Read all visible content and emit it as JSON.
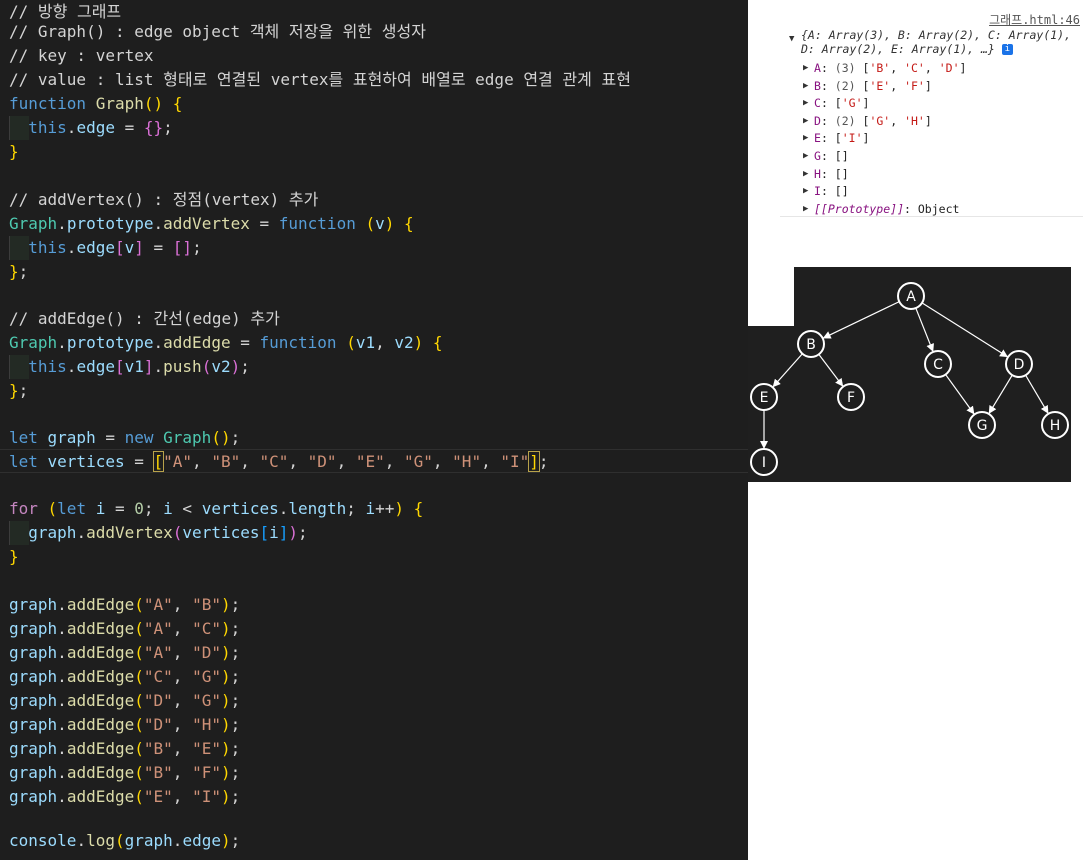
{
  "editor": {
    "lines": [
      {
        "t": 0,
        "parts": [
          {
            "c": "c-comment",
            "s": "// 방향 그래프"
          }
        ]
      },
      {
        "t": 20,
        "parts": [
          {
            "c": "c-comment",
            "s": "// Graph() : edge object 객체 저장을 위한 생성자"
          }
        ]
      },
      {
        "t": 44,
        "parts": [
          {
            "c": "c-comment",
            "s": "// key : vertex"
          }
        ]
      },
      {
        "t": 68,
        "parts": [
          {
            "c": "c-comment",
            "s": "// value : list 형태로 연결된 vertex를 표현하여 배열로 edge 연결 관계 표현"
          }
        ]
      },
      {
        "t": 92,
        "parts": [
          {
            "c": "c-kw",
            "s": "function "
          },
          {
            "c": "c-fn",
            "s": "Graph"
          },
          {
            "c": "c-b1",
            "s": "() {"
          }
        ]
      },
      {
        "t": 116,
        "guide": true,
        "parts": [
          {
            "c": "",
            "s": "  "
          },
          {
            "c": "c-kw",
            "s": "this"
          },
          {
            "c": "",
            "s": "."
          },
          {
            "c": "c-var",
            "s": "edge"
          },
          {
            "c": "",
            "s": " = "
          },
          {
            "c": "c-b2",
            "s": "{}"
          },
          {
            "c": "",
            "s": ";"
          }
        ]
      },
      {
        "t": 140,
        "parts": [
          {
            "c": "c-b1",
            "s": "}"
          }
        ]
      },
      {
        "t": 188,
        "parts": [
          {
            "c": "c-comment",
            "s": "// addVertex() : 정점(vertex) 추가"
          }
        ]
      },
      {
        "t": 212,
        "parts": [
          {
            "c": "c-cls",
            "s": "Graph"
          },
          {
            "c": "",
            "s": "."
          },
          {
            "c": "c-var",
            "s": "prototype"
          },
          {
            "c": "",
            "s": "."
          },
          {
            "c": "c-fn",
            "s": "addVertex"
          },
          {
            "c": "",
            "s": " = "
          },
          {
            "c": "c-kw",
            "s": "function "
          },
          {
            "c": "c-b1",
            "s": "("
          },
          {
            "c": "c-var",
            "s": "v"
          },
          {
            "c": "c-b1",
            "s": ")"
          },
          {
            "c": "",
            "s": " "
          },
          {
            "c": "c-b1",
            "s": "{"
          }
        ]
      },
      {
        "t": 236,
        "guide": true,
        "parts": [
          {
            "c": "",
            "s": "  "
          },
          {
            "c": "c-kw",
            "s": "this"
          },
          {
            "c": "",
            "s": "."
          },
          {
            "c": "c-var",
            "s": "edge"
          },
          {
            "c": "c-b2",
            "s": "["
          },
          {
            "c": "c-var",
            "s": "v"
          },
          {
            "c": "c-b2",
            "s": "]"
          },
          {
            "c": "",
            "s": " = "
          },
          {
            "c": "c-b2",
            "s": "[]"
          },
          {
            "c": "",
            "s": ";"
          }
        ]
      },
      {
        "t": 260,
        "parts": [
          {
            "c": "c-b1",
            "s": "}"
          },
          {
            "c": "",
            "s": ";"
          }
        ]
      },
      {
        "t": 307,
        "parts": [
          {
            "c": "c-comment",
            "s": "// addEdge() : 간선(edge) 추가"
          }
        ]
      },
      {
        "t": 331,
        "parts": [
          {
            "c": "c-cls",
            "s": "Graph"
          },
          {
            "c": "",
            "s": "."
          },
          {
            "c": "c-var",
            "s": "prototype"
          },
          {
            "c": "",
            "s": "."
          },
          {
            "c": "c-fn",
            "s": "addEdge"
          },
          {
            "c": "",
            "s": " = "
          },
          {
            "c": "c-kw",
            "s": "function "
          },
          {
            "c": "c-b1",
            "s": "("
          },
          {
            "c": "c-var",
            "s": "v1"
          },
          {
            "c": "",
            "s": ", "
          },
          {
            "c": "c-var",
            "s": "v2"
          },
          {
            "c": "c-b1",
            "s": ")"
          },
          {
            "c": "",
            "s": " "
          },
          {
            "c": "c-b1",
            "s": "{"
          }
        ]
      },
      {
        "t": 355,
        "guide": true,
        "parts": [
          {
            "c": "",
            "s": "  "
          },
          {
            "c": "c-kw",
            "s": "this"
          },
          {
            "c": "",
            "s": "."
          },
          {
            "c": "c-var",
            "s": "edge"
          },
          {
            "c": "c-b2",
            "s": "["
          },
          {
            "c": "c-var",
            "s": "v1"
          },
          {
            "c": "c-b2",
            "s": "]"
          },
          {
            "c": "",
            "s": "."
          },
          {
            "c": "c-fn",
            "s": "push"
          },
          {
            "c": "c-b2",
            "s": "("
          },
          {
            "c": "c-var",
            "s": "v2"
          },
          {
            "c": "c-b2",
            "s": ")"
          },
          {
            "c": "",
            "s": ";"
          }
        ]
      },
      {
        "t": 379,
        "parts": [
          {
            "c": "c-b1",
            "s": "}"
          },
          {
            "c": "",
            "s": ";"
          }
        ]
      },
      {
        "t": 426,
        "parts": [
          {
            "c": "c-kw",
            "s": "let "
          },
          {
            "c": "c-var",
            "s": "graph"
          },
          {
            "c": "",
            "s": " = "
          },
          {
            "c": "c-kw",
            "s": "new "
          },
          {
            "c": "c-cls",
            "s": "Graph"
          },
          {
            "c": "c-b1",
            "s": "()"
          },
          {
            "c": "",
            "s": ";"
          }
        ]
      },
      {
        "t": 450,
        "parts": [
          {
            "c": "c-kw",
            "s": "let "
          },
          {
            "c": "c-var",
            "s": "vertices"
          },
          {
            "c": "",
            "s": " = "
          },
          {
            "c": "c-b1 hl-box",
            "s": "["
          },
          {
            "c": "c-str",
            "s": "\"A\""
          },
          {
            "c": "",
            "s": ", "
          },
          {
            "c": "c-str",
            "s": "\"B\""
          },
          {
            "c": "",
            "s": ", "
          },
          {
            "c": "c-str",
            "s": "\"C\""
          },
          {
            "c": "",
            "s": ", "
          },
          {
            "c": "c-str",
            "s": "\"D\""
          },
          {
            "c": "",
            "s": ", "
          },
          {
            "c": "c-str",
            "s": "\"E\""
          },
          {
            "c": "",
            "s": ", "
          },
          {
            "c": "c-str",
            "s": "\"G\""
          },
          {
            "c": "",
            "s": ", "
          },
          {
            "c": "c-str",
            "s": "\"H\""
          },
          {
            "c": "",
            "s": ", "
          },
          {
            "c": "c-str",
            "s": "\"I\""
          },
          {
            "c": "c-b1 hl-box",
            "s": "]"
          },
          {
            "c": "",
            "s": ";"
          }
        ]
      },
      {
        "t": 497,
        "parts": [
          {
            "c": "c-ctl",
            "s": "for "
          },
          {
            "c": "c-b1",
            "s": "("
          },
          {
            "c": "c-kw",
            "s": "let "
          },
          {
            "c": "c-var",
            "s": "i"
          },
          {
            "c": "",
            "s": " = "
          },
          {
            "c": "c-num",
            "s": "0"
          },
          {
            "c": "",
            "s": "; "
          },
          {
            "c": "c-var",
            "s": "i"
          },
          {
            "c": "",
            "s": " < "
          },
          {
            "c": "c-var",
            "s": "vertices"
          },
          {
            "c": "",
            "s": "."
          },
          {
            "c": "c-var",
            "s": "length"
          },
          {
            "c": "",
            "s": "; "
          },
          {
            "c": "c-var",
            "s": "i"
          },
          {
            "c": "",
            "s": "++"
          },
          {
            "c": "c-b1",
            "s": ")"
          },
          {
            "c": "",
            "s": " "
          },
          {
            "c": "c-b1",
            "s": "{"
          }
        ]
      },
      {
        "t": 521,
        "guide": true,
        "parts": [
          {
            "c": "",
            "s": "  "
          },
          {
            "c": "c-var",
            "s": "graph"
          },
          {
            "c": "",
            "s": "."
          },
          {
            "c": "c-fn",
            "s": "addVertex"
          },
          {
            "c": "c-b2",
            "s": "("
          },
          {
            "c": "c-var",
            "s": "vertices"
          },
          {
            "c": "c-b3",
            "s": "["
          },
          {
            "c": "c-var",
            "s": "i"
          },
          {
            "c": "c-b3",
            "s": "]"
          },
          {
            "c": "c-b2",
            "s": ")"
          },
          {
            "c": "",
            "s": ";"
          }
        ]
      },
      {
        "t": 545,
        "parts": [
          {
            "c": "c-b1",
            "s": "}"
          }
        ]
      },
      {
        "t": 593,
        "parts": [
          {
            "c": "c-var",
            "s": "graph"
          },
          {
            "c": "",
            "s": "."
          },
          {
            "c": "c-fn",
            "s": "addEdge"
          },
          {
            "c": "c-b1",
            "s": "("
          },
          {
            "c": "c-str",
            "s": "\"A\""
          },
          {
            "c": "",
            "s": ", "
          },
          {
            "c": "c-str",
            "s": "\"B\""
          },
          {
            "c": "c-b1",
            "s": ")"
          },
          {
            "c": "",
            "s": ";"
          }
        ]
      },
      {
        "t": 617,
        "parts": [
          {
            "c": "c-var",
            "s": "graph"
          },
          {
            "c": "",
            "s": "."
          },
          {
            "c": "c-fn",
            "s": "addEdge"
          },
          {
            "c": "c-b1",
            "s": "("
          },
          {
            "c": "c-str",
            "s": "\"A\""
          },
          {
            "c": "",
            "s": ", "
          },
          {
            "c": "c-str",
            "s": "\"C\""
          },
          {
            "c": "c-b1",
            "s": ")"
          },
          {
            "c": "",
            "s": ";"
          }
        ]
      },
      {
        "t": 641,
        "parts": [
          {
            "c": "c-var",
            "s": "graph"
          },
          {
            "c": "",
            "s": "."
          },
          {
            "c": "c-fn",
            "s": "addEdge"
          },
          {
            "c": "c-b1",
            "s": "("
          },
          {
            "c": "c-str",
            "s": "\"A\""
          },
          {
            "c": "",
            "s": ", "
          },
          {
            "c": "c-str",
            "s": "\"D\""
          },
          {
            "c": "c-b1",
            "s": ")"
          },
          {
            "c": "",
            "s": ";"
          }
        ]
      },
      {
        "t": 665,
        "parts": [
          {
            "c": "c-var",
            "s": "graph"
          },
          {
            "c": "",
            "s": "."
          },
          {
            "c": "c-fn",
            "s": "addEdge"
          },
          {
            "c": "c-b1",
            "s": "("
          },
          {
            "c": "c-str",
            "s": "\"C\""
          },
          {
            "c": "",
            "s": ", "
          },
          {
            "c": "c-str",
            "s": "\"G\""
          },
          {
            "c": "c-b1",
            "s": ")"
          },
          {
            "c": "",
            "s": ";"
          }
        ]
      },
      {
        "t": 689,
        "parts": [
          {
            "c": "c-var",
            "s": "graph"
          },
          {
            "c": "",
            "s": "."
          },
          {
            "c": "c-fn",
            "s": "addEdge"
          },
          {
            "c": "c-b1",
            "s": "("
          },
          {
            "c": "c-str",
            "s": "\"D\""
          },
          {
            "c": "",
            "s": ", "
          },
          {
            "c": "c-str",
            "s": "\"G\""
          },
          {
            "c": "c-b1",
            "s": ")"
          },
          {
            "c": "",
            "s": ";"
          }
        ]
      },
      {
        "t": 713,
        "parts": [
          {
            "c": "c-var",
            "s": "graph"
          },
          {
            "c": "",
            "s": "."
          },
          {
            "c": "c-fn",
            "s": "addEdge"
          },
          {
            "c": "c-b1",
            "s": "("
          },
          {
            "c": "c-str",
            "s": "\"D\""
          },
          {
            "c": "",
            "s": ", "
          },
          {
            "c": "c-str",
            "s": "\"H\""
          },
          {
            "c": "c-b1",
            "s": ")"
          },
          {
            "c": "",
            "s": ";"
          }
        ]
      },
      {
        "t": 737,
        "parts": [
          {
            "c": "c-var",
            "s": "graph"
          },
          {
            "c": "",
            "s": "."
          },
          {
            "c": "c-fn",
            "s": "addEdge"
          },
          {
            "c": "c-b1",
            "s": "("
          },
          {
            "c": "c-str",
            "s": "\"B\""
          },
          {
            "c": "",
            "s": ", "
          },
          {
            "c": "c-str",
            "s": "\"E\""
          },
          {
            "c": "c-b1",
            "s": ")"
          },
          {
            "c": "",
            "s": ";"
          }
        ]
      },
      {
        "t": 761,
        "parts": [
          {
            "c": "c-var",
            "s": "graph"
          },
          {
            "c": "",
            "s": "."
          },
          {
            "c": "c-fn",
            "s": "addEdge"
          },
          {
            "c": "c-b1",
            "s": "("
          },
          {
            "c": "c-str",
            "s": "\"B\""
          },
          {
            "c": "",
            "s": ", "
          },
          {
            "c": "c-str",
            "s": "\"F\""
          },
          {
            "c": "c-b1",
            "s": ")"
          },
          {
            "c": "",
            "s": ";"
          }
        ]
      },
      {
        "t": 785,
        "parts": [
          {
            "c": "c-var",
            "s": "graph"
          },
          {
            "c": "",
            "s": "."
          },
          {
            "c": "c-fn",
            "s": "addEdge"
          },
          {
            "c": "c-b1",
            "s": "("
          },
          {
            "c": "c-str",
            "s": "\"E\""
          },
          {
            "c": "",
            "s": ", "
          },
          {
            "c": "c-str",
            "s": "\"I\""
          },
          {
            "c": "c-b1",
            "s": ")"
          },
          {
            "c": "",
            "s": ";"
          }
        ]
      },
      {
        "t": 829,
        "parts": [
          {
            "c": "c-var",
            "s": "console"
          },
          {
            "c": "",
            "s": "."
          },
          {
            "c": "c-fn",
            "s": "log"
          },
          {
            "c": "c-b1",
            "s": "("
          },
          {
            "c": "c-var",
            "s": "graph"
          },
          {
            "c": "",
            "s": "."
          },
          {
            "c": "c-var",
            "s": "edge"
          },
          {
            "c": "c-b1",
            "s": ")"
          },
          {
            "c": "",
            "s": ";"
          }
        ]
      }
    ]
  },
  "console": {
    "source_link": "그래프.html:46",
    "summary_line1": "{A: Array(3), B: Array(2), C: Array(1),",
    "summary_line2": "D: Array(2), E: Array(1), …}",
    "info_badge": "i",
    "entries": [
      {
        "key": "A",
        "count": "(3)",
        "values": [
          "'B'",
          "'C'",
          "'D'"
        ]
      },
      {
        "key": "B",
        "count": "(2)",
        "values": [
          "'E'",
          "'F'"
        ]
      },
      {
        "key": "C",
        "count": "",
        "values": [
          "'G'"
        ]
      },
      {
        "key": "D",
        "count": "(2)",
        "values": [
          "'G'",
          "'H'"
        ]
      },
      {
        "key": "E",
        "count": "",
        "values": [
          "'I'"
        ]
      },
      {
        "key": "G",
        "count": "",
        "values": []
      },
      {
        "key": "H",
        "count": "",
        "values": []
      },
      {
        "key": "I",
        "count": "",
        "values": []
      }
    ],
    "prototype_key": "[[Prototype]]",
    "prototype_value": "Object"
  },
  "graph_diagram": {
    "nodes": [
      {
        "id": "A"
      },
      {
        "id": "B"
      },
      {
        "id": "C"
      },
      {
        "id": "D"
      },
      {
        "id": "E"
      },
      {
        "id": "F"
      },
      {
        "id": "G"
      },
      {
        "id": "H"
      },
      {
        "id": "I"
      }
    ],
    "edges": [
      [
        "A",
        "B"
      ],
      [
        "A",
        "C"
      ],
      [
        "A",
        "D"
      ],
      [
        "B",
        "E"
      ],
      [
        "B",
        "F"
      ],
      [
        "C",
        "G"
      ],
      [
        "D",
        "G"
      ],
      [
        "D",
        "H"
      ],
      [
        "E",
        "I"
      ]
    ],
    "colors": {
      "background": "#1f1f1f",
      "stroke": "#ffffff",
      "node_fill": "#1f1f1f"
    }
  }
}
